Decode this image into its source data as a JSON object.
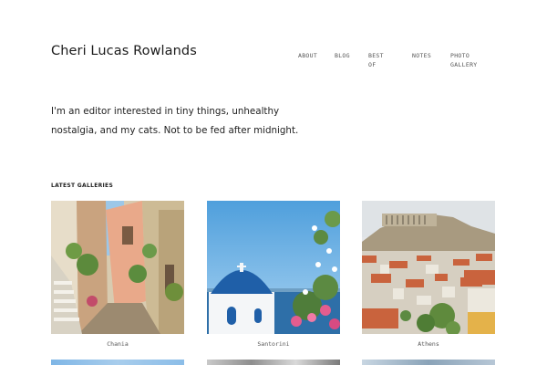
{
  "site": {
    "title": "Cheri Lucas Rowlands"
  },
  "nav": {
    "items": [
      {
        "label": "About"
      },
      {
        "label": "Blog"
      },
      {
        "label": "Best of"
      },
      {
        "label": "Notes"
      },
      {
        "label": "Photo Gallery"
      }
    ]
  },
  "intro": {
    "text": "I'm an editor interested in tiny things, unhealthy nostalgia, and my cats. Not to be fed after midnight."
  },
  "galleries": {
    "heading": "LATEST GALLERIES",
    "items": [
      {
        "caption": "Chania"
      },
      {
        "caption": "Santorini"
      },
      {
        "caption": "Athens"
      }
    ]
  },
  "colors": {
    "text": "#222222",
    "nav_text": "#555555",
    "santorini_sky": "#5fa9e0",
    "santorini_dome": "#1f5fa8",
    "athens_rooftops": "#c9633d"
  }
}
